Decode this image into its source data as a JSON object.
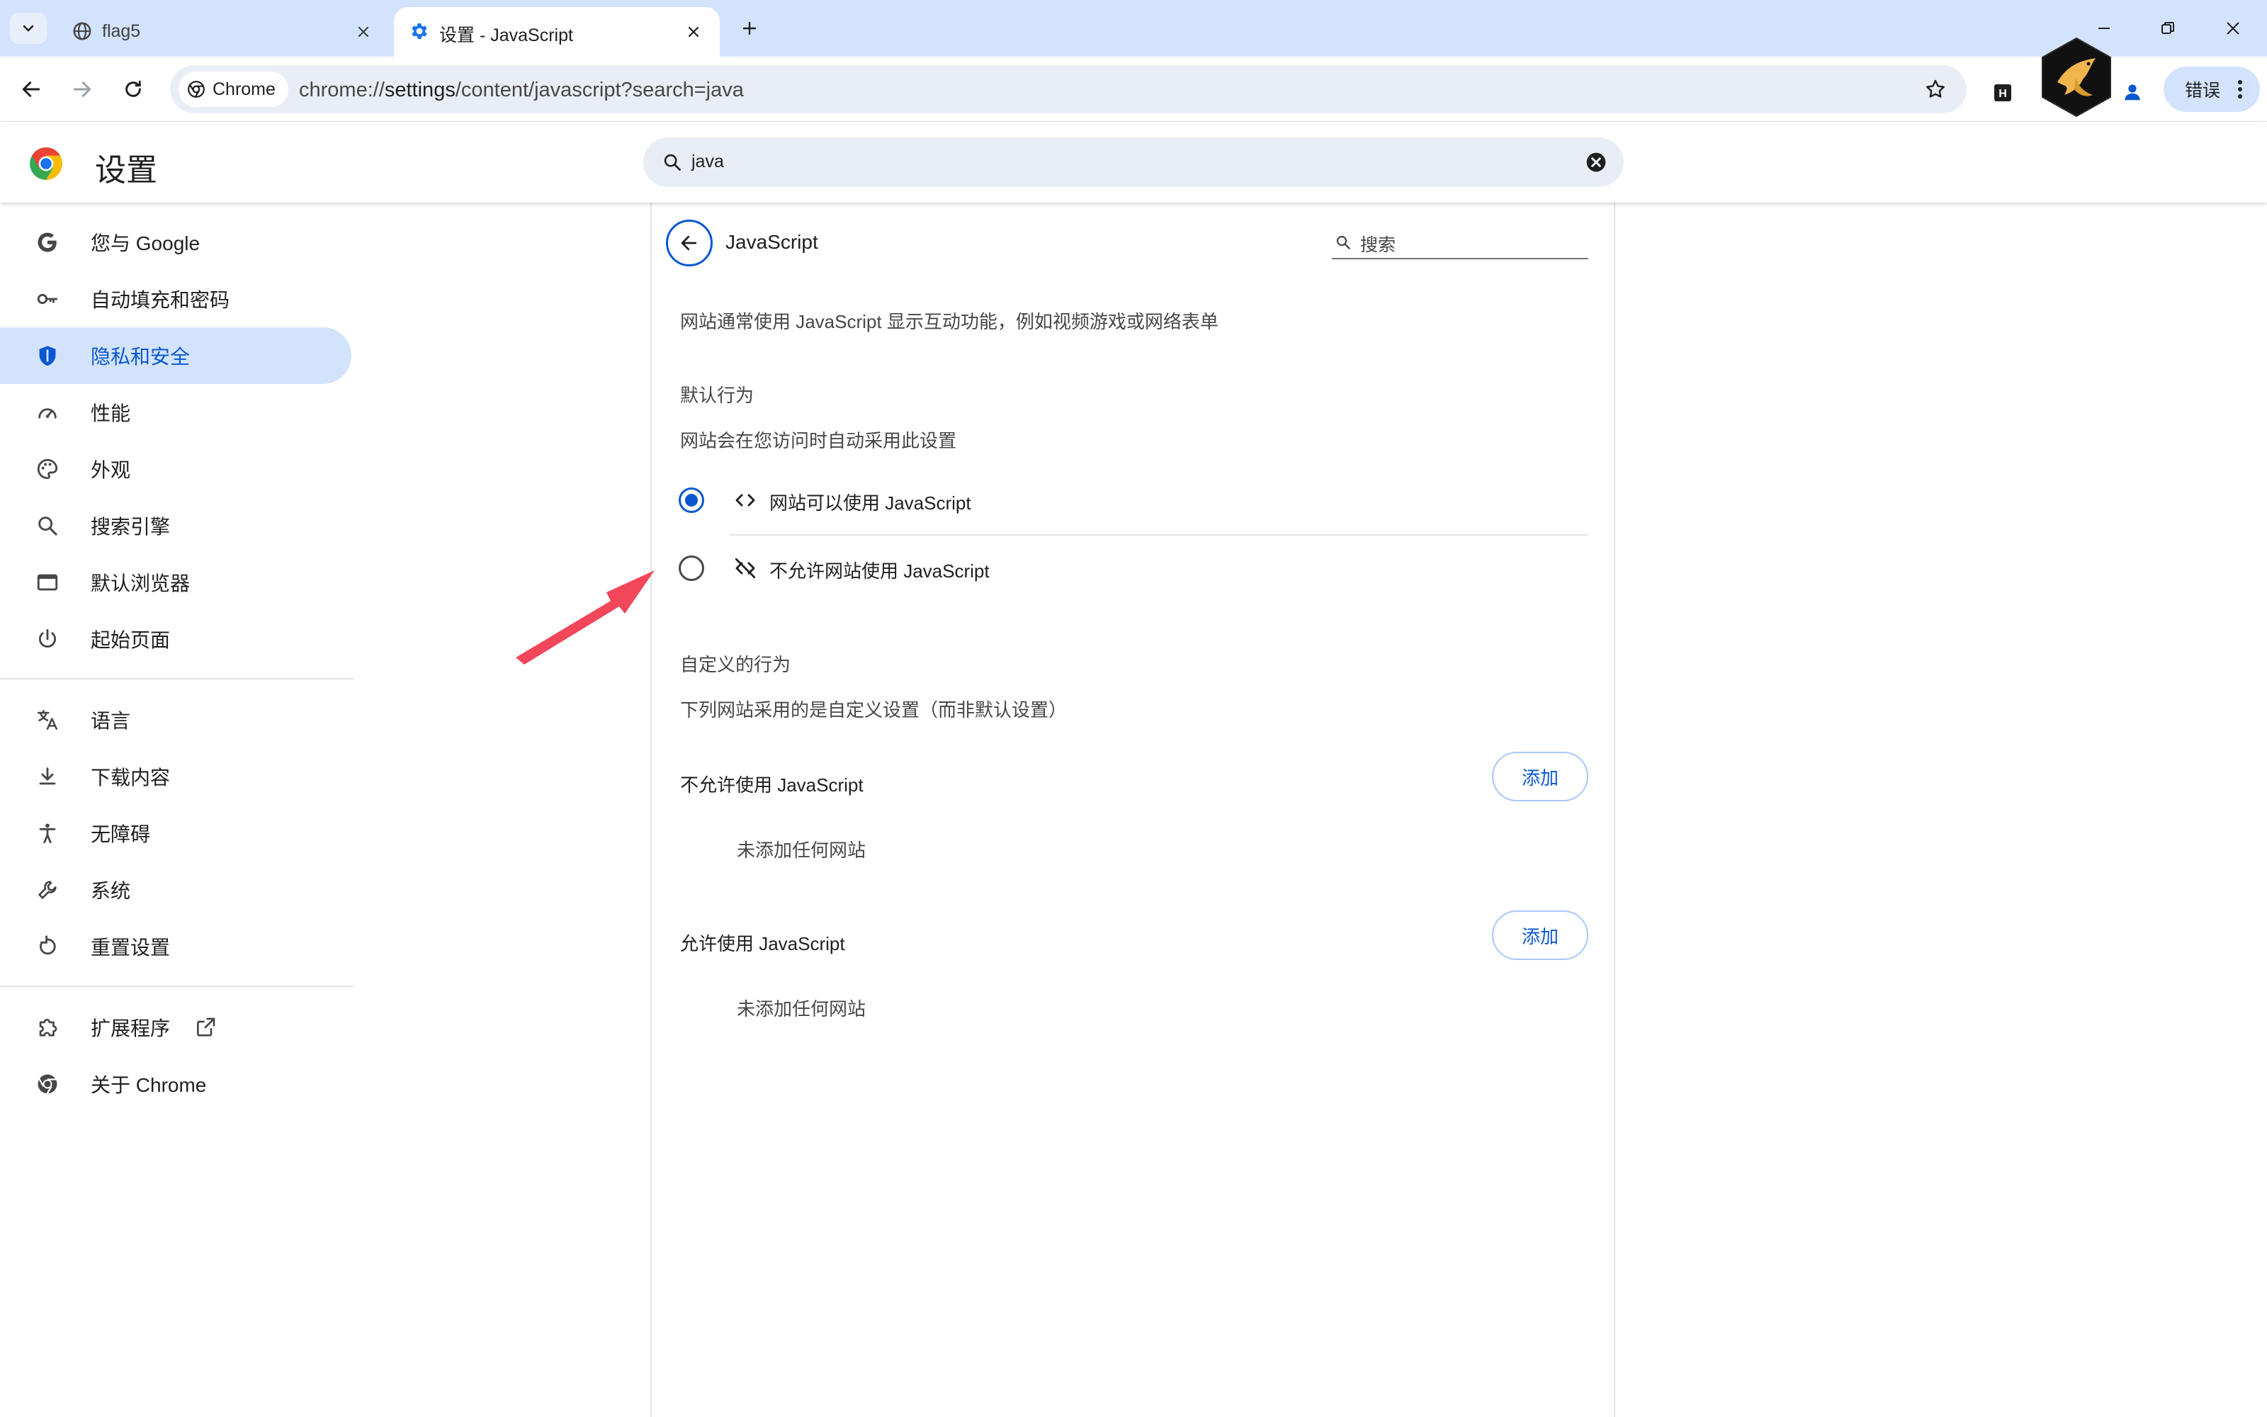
{
  "browser": {
    "tabs": [
      {
        "title": "flag5",
        "active": false
      },
      {
        "title": "设置 - JavaScript",
        "active": true
      }
    ],
    "omnibox": {
      "chip_label": "Chrome",
      "url_scheme": "chrome://",
      "url_host": "settings",
      "url_path": "/content/javascript?search=java"
    },
    "error_button_label": "错误",
    "extension_label": "H"
  },
  "settings": {
    "title": "设置",
    "search_query": "java"
  },
  "sidebar": {
    "group1": [
      {
        "label": "您与 Google",
        "icon": "google-g-icon",
        "selected": false
      },
      {
        "label": "自动填充和密码",
        "icon": "key-icon",
        "selected": false
      },
      {
        "label": "隐私和安全",
        "icon": "shield-icon",
        "selected": true
      },
      {
        "label": "性能",
        "icon": "speedometer-icon",
        "selected": false
      },
      {
        "label": "外观",
        "icon": "palette-icon",
        "selected": false
      },
      {
        "label": "搜索引擎",
        "icon": "search-icon",
        "selected": false
      },
      {
        "label": "默认浏览器",
        "icon": "browser-window-icon",
        "selected": false
      },
      {
        "label": "起始页面",
        "icon": "power-icon",
        "selected": false
      }
    ],
    "group2": [
      {
        "label": "语言",
        "icon": "translate-icon"
      },
      {
        "label": "下载内容",
        "icon": "download-icon"
      },
      {
        "label": "无障碍",
        "icon": "accessibility-icon"
      },
      {
        "label": "系统",
        "icon": "wrench-icon"
      },
      {
        "label": "重置设置",
        "icon": "reset-icon"
      }
    ],
    "group3": [
      {
        "label": "扩展程序",
        "icon": "puzzle-icon"
      },
      {
        "label": "关于 Chrome",
        "icon": "chrome-icon"
      }
    ]
  },
  "page": {
    "title": "JavaScript",
    "search_placeholder": "搜索",
    "description": "网站通常使用 JavaScript 显示互动功能，例如视频游戏或网络表单",
    "default_heading": "默认行为",
    "default_sub": "网站会在您访问时自动采用此设置",
    "options": [
      {
        "label": "网站可以使用 JavaScript",
        "icon": "code-icon",
        "checked": true
      },
      {
        "label": "不允许网站使用 JavaScript",
        "icon": "code-off-icon",
        "checked": false
      }
    ],
    "custom_heading": "自定义的行为",
    "custom_sub": "下列网站采用的是自定义设置（而非默认设置）",
    "blocked": {
      "label": "不允许使用 JavaScript",
      "add_label": "添加",
      "empty": "未添加任何网站"
    },
    "allowed": {
      "label": "允许使用 JavaScript",
      "add_label": "添加",
      "empty": "未添加任何网站"
    }
  },
  "colors": {
    "accent": "#0b57d0",
    "selected_bg": "#d3e3fd",
    "tabstrip_bg": "#d3e3fd",
    "annotation_arrow": "#f2475a"
  }
}
